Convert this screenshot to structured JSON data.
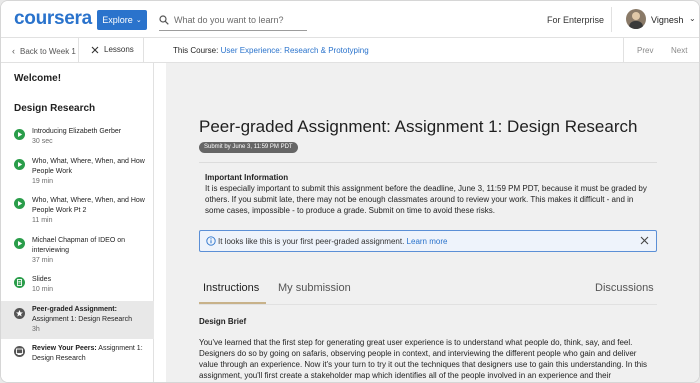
{
  "header": {
    "logo": "coursera",
    "explore_label": "Explore",
    "search_placeholder": "What do you want to learn?",
    "enterprise_label": "For Enterprise",
    "user_name": "Vignesh"
  },
  "subbar": {
    "back_label": "Back to Week 1",
    "lessons_label": "Lessons",
    "course_prefix": "This Course:",
    "course_name": "User Experience: Research & Prototyping",
    "prev_label": "Prev",
    "next_label": "Next"
  },
  "sidebar": {
    "welcome": "Welcome!",
    "section_title": "Design Research",
    "items": [
      {
        "title": "Introducing Elizabeth Gerber",
        "meta": "30 sec",
        "icon": "play-icon"
      },
      {
        "title": "Who, What, Where, When, and How People Work",
        "meta": "19 min",
        "icon": "play-icon"
      },
      {
        "title": "Who, What, Where, When, and How People Work Pt 2",
        "meta": "11 min",
        "icon": "play-icon"
      },
      {
        "title": "Michael Chapman of IDEO on interviewing",
        "meta": "37 min",
        "icon": "play-icon"
      },
      {
        "title": "Slides",
        "meta": "10 min",
        "icon": "document-icon"
      },
      {
        "title_bold": "Peer-graded Assignment:",
        "title_rest": "Assignment 1: Design Research",
        "meta": "3h",
        "icon": "star-icon"
      },
      {
        "title_bold": "Review Your Peers:",
        "title_rest": "Assignment 1: Design Research",
        "icon": "review-icon"
      }
    ]
  },
  "main": {
    "title": "Peer-graded Assignment: Assignment 1: Design Research",
    "badge": "Submit by June 3, 11:59 PM PDT",
    "important_title": "Important Information",
    "important_body": "It is especially important to submit this assignment before the deadline, June 3, 11:59 PM PDT, because it must be graded by others. If you submit late, there may not be enough classmates around to review your work. This makes it difficult - and in some cases, impossible - to produce a grade. Submit on time to avoid these risks.",
    "note_text": "It looks like this is your first peer-graded assignment.",
    "note_link": "Learn more",
    "tabs": [
      "Instructions",
      "My submission"
    ],
    "discussions_label": "Discussions",
    "brief_title": "Design Brief",
    "brief_body": "You've learned that the first step for generating great user experience is to understand what people do, think, say, and feel. Designers do so by going on safaris, observing people in context, and interviewing the different people who gain and deliver value through an experience. Now it's your turn to try it out the techniques that designers use to gain this understanding. In this assignment, you'll first create a stakeholder map which identifies all of the people involved in an experience and their"
  },
  "colors": {
    "brand": "#2a73cc",
    "complete_green": "#2a9d4a"
  }
}
